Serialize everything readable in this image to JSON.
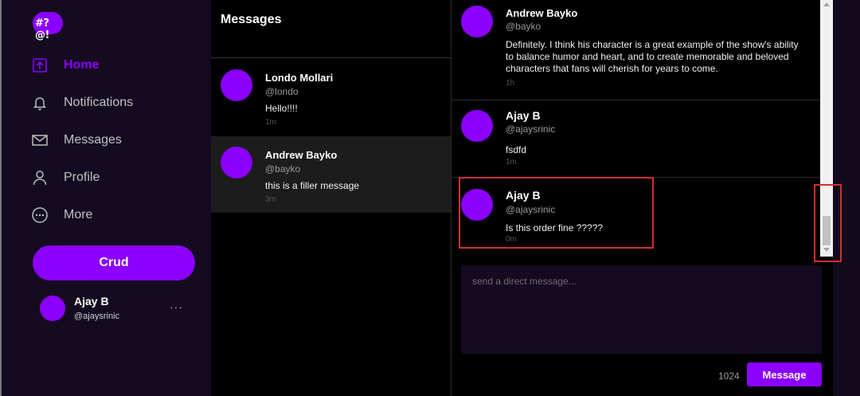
{
  "sidebar": {
    "logo_text": "#?@!",
    "nav": [
      {
        "label": "Home",
        "icon": "home-icon",
        "active": true
      },
      {
        "label": "Notifications",
        "icon": "bell-icon"
      },
      {
        "label": "Messages",
        "icon": "mail-icon"
      },
      {
        "label": "Profile",
        "icon": "user-icon"
      },
      {
        "label": "More",
        "icon": "more-circle-icon"
      }
    ],
    "crud_label": "Crud",
    "profile": {
      "name": "Ajay B",
      "handle": "@ajaysrinic",
      "more": "···"
    }
  },
  "conversations": {
    "title": "Messages",
    "items": [
      {
        "name": "Londo Mollari",
        "handle": "@londo",
        "text": "Hello!!!!",
        "time": "1m"
      },
      {
        "name": "Andrew Bayko",
        "handle": "@bayko",
        "text": "this is a filler message",
        "time": "3m",
        "selected": true
      }
    ]
  },
  "chat": {
    "messages": [
      {
        "name": "Andrew Bayko",
        "handle": "@bayko",
        "text": "Definitely. I think his character is a great example of the show's ability to balance humor and heart, and to create memorable and beloved characters that fans will cherish for years to come.",
        "time": "1h"
      },
      {
        "name": "Ajay B",
        "handle": "@ajaysrinic",
        "text": "fsdfd",
        "time": "1m"
      },
      {
        "name": "Ajay B",
        "handle": "@ajaysrinic",
        "text": "Is this order fine ?????",
        "time": "0m"
      }
    ],
    "input_placeholder": "send a direct message...",
    "char_count": "1024",
    "send_label": "Message"
  },
  "colors": {
    "accent": "#8b00ff",
    "background": "#000000",
    "sidebar": "#150b21",
    "highlight": "#d32f2f"
  }
}
